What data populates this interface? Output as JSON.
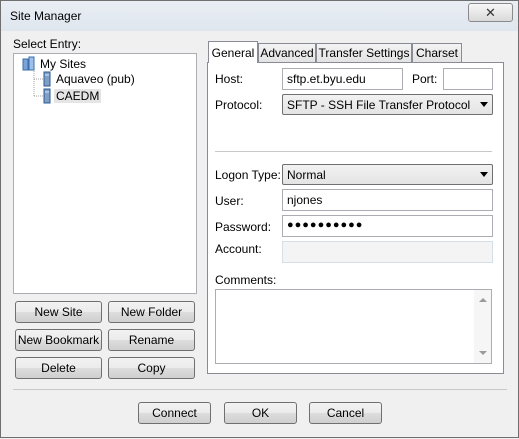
{
  "window": {
    "title": "Site Manager",
    "close_glyph": "✕"
  },
  "left": {
    "label": "Select Entry:",
    "tree": {
      "root": "My Sites",
      "items": [
        {
          "label": "Aquaveo (pub)",
          "icon": "server-icon",
          "selected": false
        },
        {
          "label": "CAEDM",
          "icon": "server-icon",
          "selected": true
        }
      ]
    },
    "buttons": {
      "new_site": "New Site",
      "new_folder": "New Folder",
      "new_bookmark": "New Bookmark",
      "rename": "Rename",
      "delete": "Delete",
      "copy": "Copy"
    }
  },
  "tabs": [
    {
      "label": "General",
      "active": true
    },
    {
      "label": "Advanced",
      "active": false
    },
    {
      "label": "Transfer Settings",
      "active": false
    },
    {
      "label": "Charset",
      "active": false
    }
  ],
  "general": {
    "host_label": "Host:",
    "host_value": "sftp.et.byu.edu",
    "port_label": "Port:",
    "port_value": "",
    "protocol_label": "Protocol:",
    "protocol_value": "SFTP - SSH File Transfer Protocol",
    "logon_type_label": "Logon Type:",
    "logon_type_value": "Normal",
    "user_label": "User:",
    "user_value": "njones",
    "password_label": "Password:",
    "password_value": "●●●●●●●●●●",
    "account_label": "Account:",
    "account_value": "",
    "comments_label": "Comments:",
    "comments_value": ""
  },
  "footer": {
    "connect": "Connect",
    "ok": "OK",
    "cancel": "Cancel"
  }
}
